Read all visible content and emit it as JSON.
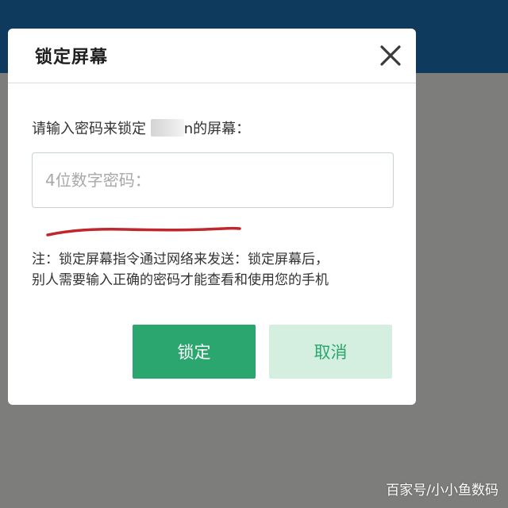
{
  "dialog": {
    "title": "锁定屏幕",
    "close_icon": "close-icon",
    "prompt_prefix": "请输入密码来锁定",
    "prompt_name_tail": "n",
    "prompt_suffix": "的屏幕：",
    "password_placeholder": "4位数字密码：",
    "password_value": "",
    "note_line1": "注：锁定屏幕指令通过网络来发送：锁定屏幕后，",
    "note_line2": "别人需要输入正确的密码才能查看和使用您的手机",
    "lock_label": "锁定",
    "cancel_label": "取消"
  },
  "watermark": "百家号/小小鱼数码",
  "colors": {
    "top_bar": "#0e3a5d",
    "backdrop": "#7d7d7b",
    "primary": "#2aa66e",
    "secondary_bg": "#d4eee0",
    "annotation_red": "#c0272d"
  }
}
